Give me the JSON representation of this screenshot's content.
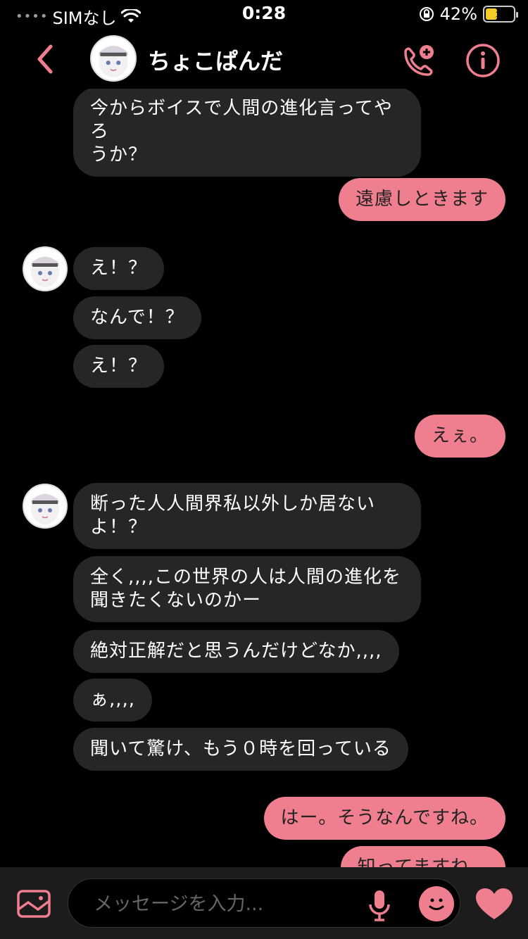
{
  "status": {
    "carrier": "SIMなし",
    "time": "0:28",
    "battery": "42%",
    "battery_level": 0.42
  },
  "header": {
    "contact_name": "ちょこぱんだ"
  },
  "messages": [
    {
      "side": "received",
      "text": "今からボイスで人間の進化言ってやろ\nうか？"
    },
    {
      "side": "sent",
      "text": "遠慮しときます"
    },
    {
      "side": "received",
      "text": "え！？"
    },
    {
      "side": "received",
      "text": "なんで！？"
    },
    {
      "side": "received",
      "text": "え！？"
    },
    {
      "side": "sent",
      "text": "えぇ。"
    },
    {
      "side": "received",
      "text": "断った人人間界私以外しか居ない\nよ！？"
    },
    {
      "side": "received",
      "text": "全く,,,,この世界の人は人間の進化を\n聞きたくないのかー"
    },
    {
      "side": "received",
      "text": "絶対正解だと思うんだけどなか,,,,"
    },
    {
      "side": "received",
      "text": "ぁ,,,,"
    },
    {
      "side": "received",
      "text": "聞いて驚け、もう０時を回っている"
    },
    {
      "side": "sent",
      "text": "はー。そうなんですね。"
    },
    {
      "side": "sent",
      "text": "知ってますね。"
    }
  ],
  "composer": {
    "placeholder": "メッセージを入力..."
  },
  "colors": {
    "accent": "#ef7f8f",
    "received_bubble": "#262626",
    "background": "#000000"
  },
  "icons": {
    "back": "chevron-left-icon",
    "call": "phone-add-icon",
    "info": "info-icon",
    "gallery": "image-icon",
    "mic": "microphone-icon",
    "sticker": "smiley-icon",
    "like": "heart-icon"
  }
}
